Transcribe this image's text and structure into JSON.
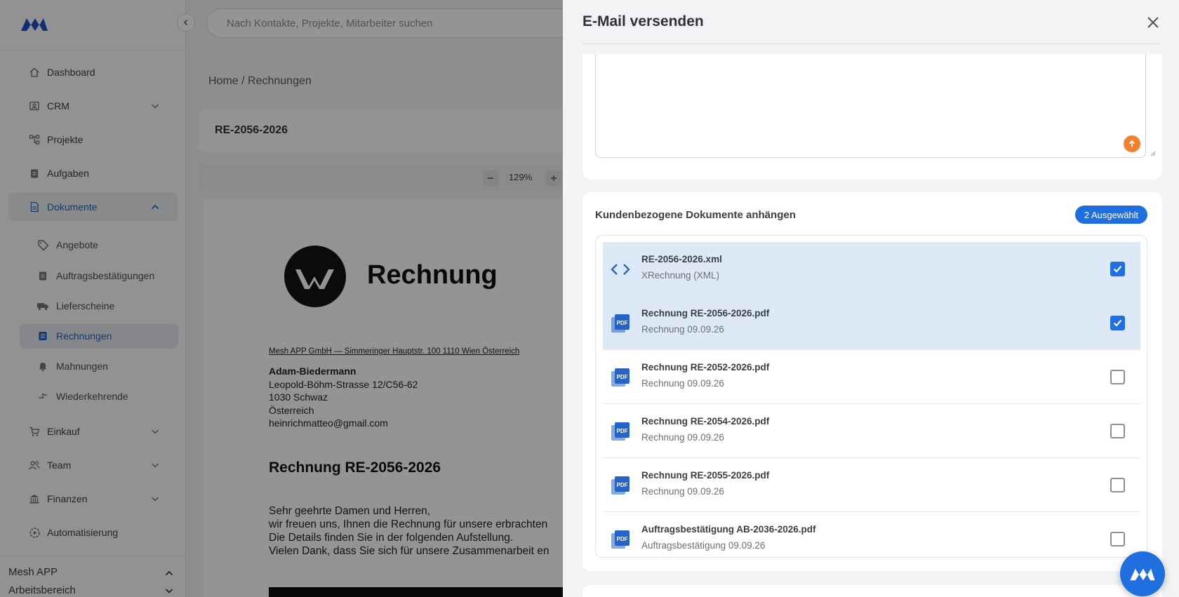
{
  "search": {
    "placeholder": "Nach Kontakte, Projekte, Mitarbeiter suchen"
  },
  "sidebar": {
    "items": [
      {
        "label": "Dashboard",
        "icon": "home-icon"
      },
      {
        "label": "CRM",
        "icon": "crm-icon"
      },
      {
        "label": "Projekte",
        "icon": "projects-icon"
      },
      {
        "label": "Aufgaben",
        "icon": "tasks-icon"
      },
      {
        "label": "Dokumente",
        "icon": "document-icon"
      },
      {
        "label": "Einkauf",
        "icon": "cart-icon"
      },
      {
        "label": "Team",
        "icon": "team-icon"
      },
      {
        "label": "Finanzen",
        "icon": "bank-icon"
      },
      {
        "label": "Automatisierung",
        "icon": "automation-icon"
      }
    ],
    "sub_items": [
      {
        "label": "Angebote",
        "icon": "tag-icon"
      },
      {
        "label": "Auftragsbestätigungen",
        "icon": "clipboard-icon"
      },
      {
        "label": "Lieferscheine",
        "icon": "truck-icon"
      },
      {
        "label": "Rechnungen",
        "icon": "invoice-icon"
      },
      {
        "label": "Mahnungen",
        "icon": "bell-icon"
      },
      {
        "label": "Wiederkehrende",
        "icon": "recurring-icon"
      }
    ],
    "workspace": {
      "company": "Mesh APP",
      "area": "Arbeitsbereich"
    }
  },
  "main": {
    "breadcrumb": "Home / Rechnungen",
    "doc_title": "RE-2056-2026",
    "zoom": "129%"
  },
  "invoice": {
    "title": "Rechnung",
    "sender": "Mesh APP GmbH — Simmeringer Hauptstr. 100 1110 Wien Österreich",
    "recipient_name": "Adam-Biedermann",
    "recipient_street": "Leopold-Böhm-Strasse 12/C56-62",
    "recipient_city": "1030 Schwaz",
    "recipient_country": "Österreich",
    "recipient_email": "heinrichmatteo@gmail.com",
    "heading": "Rechnung RE-2056-2026",
    "body": [
      "Sehr geehrte Damen und Herren,",
      "wir freuen uns, Ihnen die Rechnung für unsere erbrachten",
      "Die Details finden Sie in der folgenden Aufstellung.",
      "Vielen Dank, dass Sie sich für unsere Zusammenarbeit en"
    ]
  },
  "drawer": {
    "title": "E-Mail versenden",
    "attach_title": "Kundenbezogene Dokumente anhängen",
    "badge": "2 Ausgewählt",
    "documents": [
      {
        "name": "RE-2056-2026.xml",
        "sub": "XRechnung (XML)",
        "icon": "code-icon",
        "checked": true
      },
      {
        "name": "Rechnung RE-2056-2026.pdf",
        "sub": "Rechnung 09.09.26",
        "icon": "pdf-icon",
        "checked": true
      },
      {
        "name": "Rechnung RE-2052-2026.pdf",
        "sub": "Rechnung 09.09.26",
        "icon": "pdf-icon",
        "checked": false
      },
      {
        "name": "Rechnung RE-2054-2026.pdf",
        "sub": "Rechnung 09.09.26",
        "icon": "pdf-icon",
        "checked": false
      },
      {
        "name": "Rechnung RE-2055-2026.pdf",
        "sub": "Rechnung 09.09.26",
        "icon": "pdf-icon",
        "checked": false
      },
      {
        "name": "Auftragsbestätigung AB-2036-2026.pdf",
        "sub": "Auftragsbestätigung 09.09.26",
        "icon": "pdf-icon",
        "checked": false
      }
    ]
  },
  "colors": {
    "accent": "#1f6fe0",
    "upload": "#f0812f",
    "selected_row": "#dde9f7"
  }
}
